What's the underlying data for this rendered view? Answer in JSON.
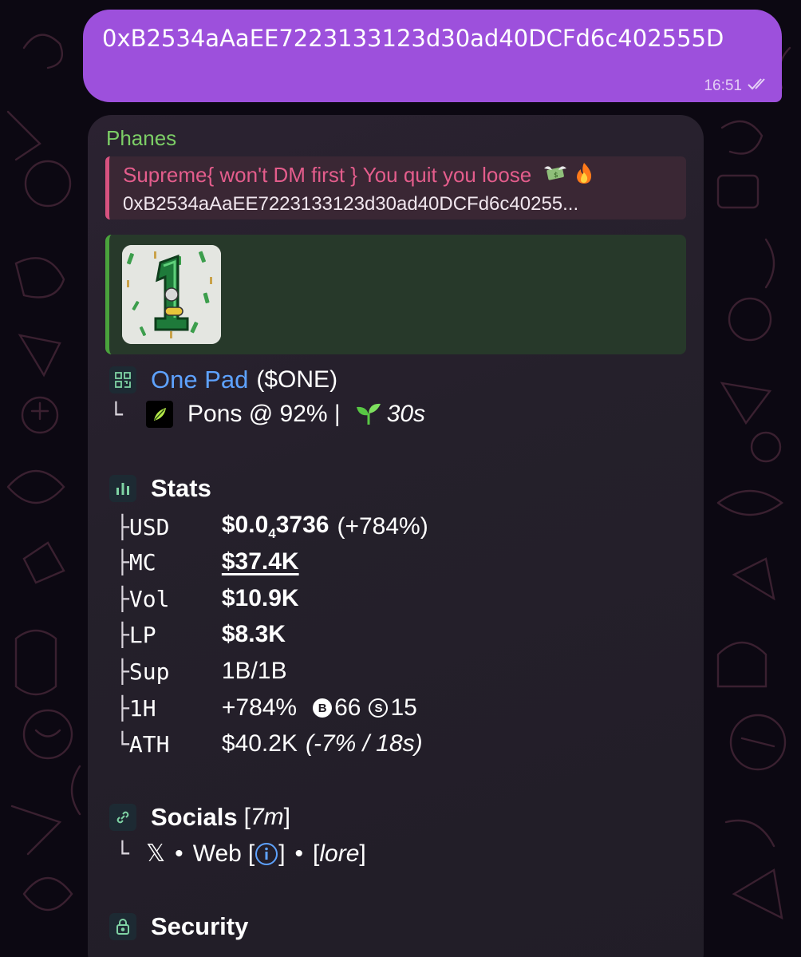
{
  "outgoing": {
    "text": "0xB2534aAaEE7223133123d30ad40DCFd6c402555D",
    "time": "16:51"
  },
  "incoming": {
    "sender": "Phanes",
    "reply": {
      "title": "Supreme{ won't DM first } You quit you loose",
      "text": "0xB2534aAaEE7223133123d30ad40DCFd6c40255..."
    },
    "token": {
      "name": "One Pad",
      "ticker": "$ONE",
      "ticker_open": "(",
      "ticker_close": ")",
      "pons": "Pons @ 92% |",
      "age": "30s"
    },
    "stats": {
      "title": "Stats",
      "usd_label": "USD",
      "usd_value_a": "$0.0",
      "usd_value_sub": "4",
      "usd_value_b": "3736",
      "usd_change": "(+784%)",
      "mc_label": "MC",
      "mc_value": "$37.4K",
      "vol_label": "Vol",
      "vol_value": "$10.9K",
      "lp_label": "LP",
      "lp_value": "$8.3K",
      "sup_label": "Sup",
      "sup_value": "1B/1B",
      "h1_label": "1H",
      "h1_value": "+784%",
      "h1_buys": "66",
      "h1_sells": "15",
      "ath_label": "ATH",
      "ath_value": "$40.2K",
      "ath_detail": "(-7% / 18s)"
    },
    "socials": {
      "title": "Socials",
      "age": "7m",
      "x": "𝕏",
      "web": "Web",
      "lore": "lore"
    },
    "security": {
      "title": "Security"
    }
  },
  "colors": {
    "outgoing_bubble": "#9d50dc",
    "incoming_bubble": "#25202b",
    "sender": "#7cce66",
    "reply_accent": "#e45d8c",
    "link": "#5ea2ff",
    "preview_accent": "#4aa23c"
  }
}
